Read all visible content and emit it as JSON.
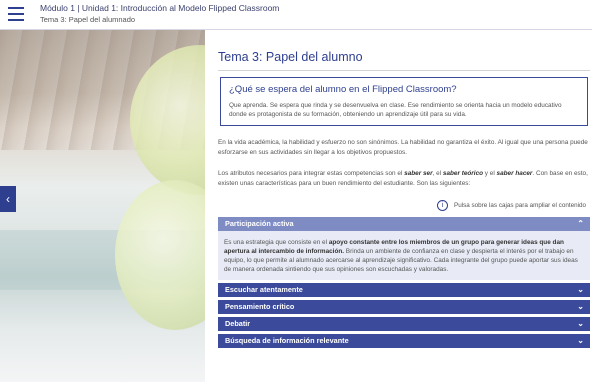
{
  "header": {
    "course": "Módulo 1 | Unidad 1: Introducción al Modelo Flipped Classroom",
    "topic": "Tema 3: Papel del alumnado"
  },
  "main": {
    "title": "Tema 3: Papel del alumno",
    "question_box": {
      "heading": "¿Qué se espera del alumno en el Flipped Classroom?",
      "text": "Que aprenda. Se espera que rinda y se desenvuelva en clase. Ese rendimiento se orienta hacia un modelo educativo donde es protagonista de su formación, obteniendo un aprendizaje útil para su vida."
    },
    "paragraph1": "En la vida académica, la habilidad y esfuerzo no son sinónimos. La habilidad no garantiza el éxito. Al igual que una persona puede esforzarse en sus actividades sin llegar a los objetivos propuestos.",
    "paragraph2_a": "Los atributos necesarios para integrar estas competencias son el ",
    "paragraph2_b1": "saber ser",
    "paragraph2_c1": ", el ",
    "paragraph2_b2": "saber teórico",
    "paragraph2_c2": " y el ",
    "paragraph2_b3": "saber hacer",
    "paragraph2_d": ". Con base en esto, existen unas características para un buen rendimiento del estudiante. Son las siguientes:",
    "hint": "Pulsa sobre las cajas para ampliar el contenido",
    "hint_icon": "info-icon",
    "accordion": [
      {
        "label": "Participación activa",
        "open": true,
        "body_a": "Es una estrategia que consiste en el ",
        "body_b": "apoyo constante entre los miembros de un grupo para generar ideas que dan apertura al intercambio de información.",
        "body_c": " Brinda un ambiente de confianza en clase y despierta el interés por el trabajo en equipo, lo que permite al alumnado acercarse al aprendizaje significativo. Cada integrante del grupo puede aportar sus ideas de manera ordenada sintiendo que sus opiniones son escuchadas y valoradas."
      },
      {
        "label": "Escuchar atentamente",
        "open": false
      },
      {
        "label": "Pensamiento crítico",
        "open": false
      },
      {
        "label": "Debatir",
        "open": false
      },
      {
        "label": "Búsqueda de información relevante",
        "open": false
      }
    ]
  },
  "icons": {
    "menu": "hamburger-menu-icon",
    "prev": "chevron-left-icon",
    "chevron_down": "chevron-down-icon",
    "chevron_up": "chevron-up-icon"
  },
  "colors": {
    "primary": "#2e3f8f",
    "accordion_bar": "#3b4a9a",
    "accordion_open": "#7f8cc4",
    "accordion_body_bg": "#e8ebf6"
  }
}
